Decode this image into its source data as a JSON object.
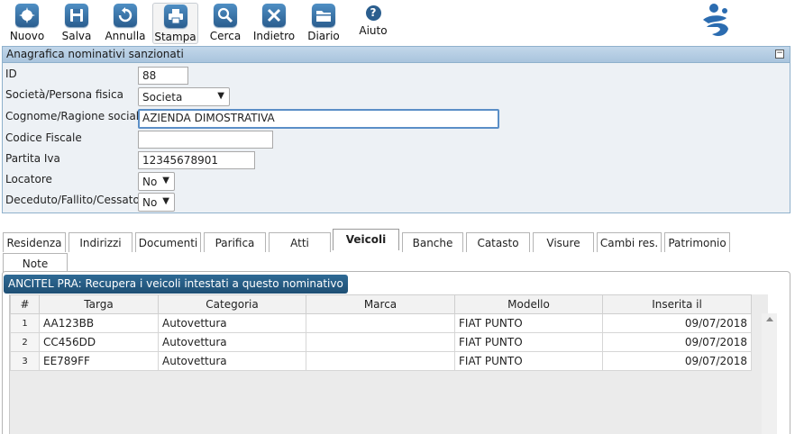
{
  "toolbar": {
    "nuovo": "Nuovo",
    "salva": "Salva",
    "annulla": "Annulla",
    "stampa": "Stampa",
    "cerca": "Cerca",
    "indietro": "Indietro",
    "diario": "Diario",
    "aiuto": "Aiuto",
    "aiuto_glyph": "?"
  },
  "panel": {
    "title": "Anagrafica nominativi sanzionati",
    "collapse_glyph": "−",
    "fields": {
      "id": {
        "label": "ID",
        "value": "88"
      },
      "tipo": {
        "label": "Società/Persona fisica",
        "value": "Societa"
      },
      "cognome": {
        "label": "Cognome/Ragione sociale",
        "value": "AZIENDA DIMOSTRATIVA"
      },
      "codice_fiscale": {
        "label": "Codice Fiscale",
        "value": ""
      },
      "partita_iva": {
        "label": "Partita Iva",
        "value": "12345678901"
      },
      "locatore": {
        "label": "Locatore",
        "value": "No"
      },
      "deceduto": {
        "label": "Deceduto/Fallito/Cessato",
        "value": "No"
      }
    }
  },
  "tabs": [
    "Residenza",
    "Indirizzi",
    "Documenti",
    "Parifica",
    "Atti",
    "Veicoli",
    "Banche",
    "Catasto",
    "Visure",
    "Cambi res.",
    "Patrimonio",
    "Note"
  ],
  "active_tab": "Veicoli",
  "ancitel_button": "ANCITEL PRA: Recupera i veicoli intestati a questo nominativo",
  "grid": {
    "headers": [
      "#",
      "Targa",
      "Categoria",
      "Marca",
      "Modello",
      "Inserita il"
    ],
    "rows": [
      [
        "1",
        "AA123BB",
        "Autovettura",
        "",
        "FIAT PUNTO",
        "09/07/2018"
      ],
      [
        "2",
        "CC456DD",
        "Autovettura",
        "",
        "FIAT PUNTO",
        "09/07/2018"
      ],
      [
        "3",
        "EE789FF",
        "Autovettura",
        "",
        "FIAT PUNTO",
        "09/07/2018"
      ]
    ]
  },
  "colors": {
    "accent": "#2b5e8e",
    "panel_header": "#b8cfe5",
    "panel_bg": "#edf1f5"
  }
}
